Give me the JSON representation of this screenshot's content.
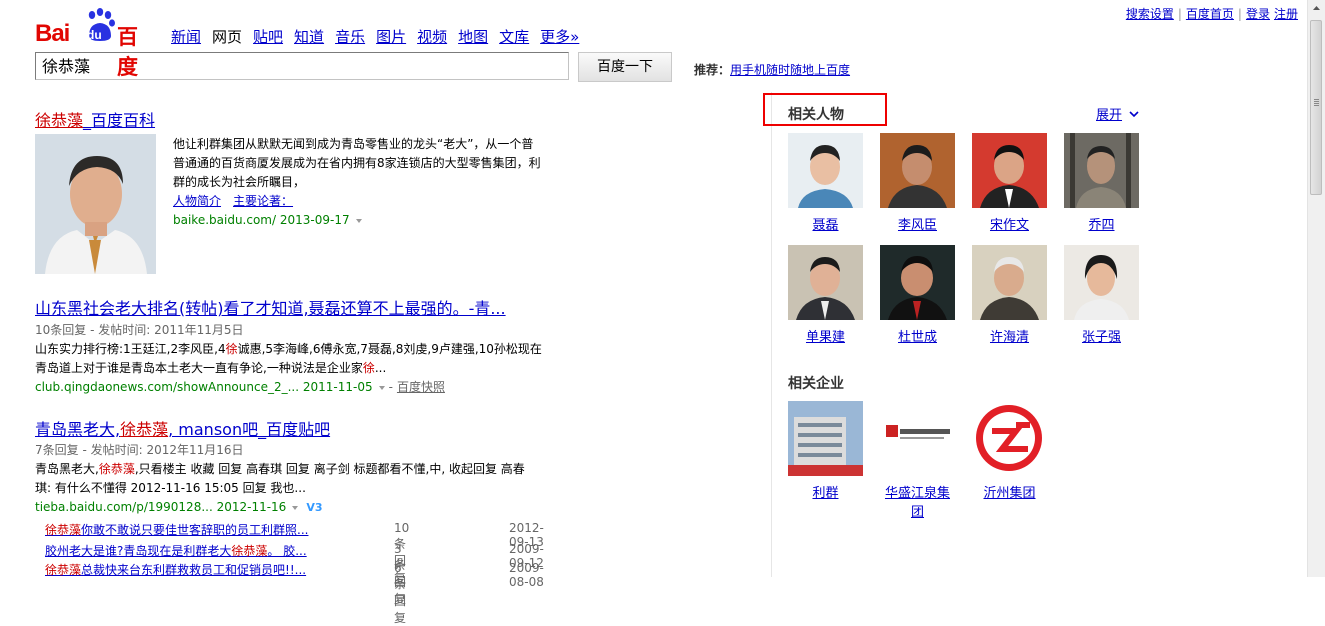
{
  "top_links": [
    "搜索设置",
    "百度首页",
    "登录",
    "注册"
  ],
  "logo": {
    "bai": "Bai",
    "du": "du",
    "cn": "百度"
  },
  "nav": [
    "新闻",
    "网页",
    "贴吧",
    "知道",
    "音乐",
    "图片",
    "视频",
    "地图",
    "文库",
    "更多»"
  ],
  "nav_current": "网页",
  "search": {
    "value": "徐恭藻",
    "button": "百度一下"
  },
  "recommend": {
    "label": "推荐：",
    "link": "用手机随时随地上百度"
  },
  "results": {
    "r1": {
      "title_q": "徐恭藻",
      "title_rest": "_百度百科",
      "desc1": "他让利群集团从默默无闻到成为青岛零售业的龙头“老大”，从一个普",
      "desc2": "普通通的百货商厦发展成为在省内拥有8家连锁店的大型零售集团，利",
      "desc3": "群的成长为社会所瞩目，",
      "link1": "人物简介",
      "link2": "主要论著：",
      "url": "baike.baidu.com/ 2013-09-17"
    },
    "r2": {
      "title": "山东黑社会老大排名(转帖)看了才知道,聂磊还算不上最强的。-青...",
      "meta": "10条回复 - 发帖时间: 2011年11月5日",
      "desc1_a": "山东实力排行榜:1王廷江,2李风臣,4",
      "desc1_q": "徐",
      "desc1_b": "诚惠,5李海峰,6傅永宽,7聂磊,8刘虔,9卢建强,10孙松现在",
      "desc2_a": "青岛道上对于谁是青岛本土老大一直有争论,一种说法是企业家",
      "desc2_q": "徐",
      "desc2_b": "...",
      "url": "club.qingdaonews.com/showAnnounce_2_... 2011-11-05",
      "snapshot": "百度快照"
    },
    "r3": {
      "title_a": "青岛黑老大,",
      "title_q": "徐恭藻",
      "title_b": ", manson吧_百度贴吧",
      "meta": "7条回复 - 发帖时间: 2012年11月16日",
      "desc1_a": "青岛黑老大,",
      "desc1_q": "徐恭藻",
      "desc1_b": ",只看楼主 收藏 回复 高春琪 回复 离子剑 标题都看不懂,中, 收起回复 高春",
      "desc2": "琪: 有什么不懂得 2012-11-16 15:05 回复 我也...",
      "url": "tieba.baidu.com/p/1990128... 2012-11-16",
      "badge": "V3",
      "sub": [
        {
          "q": "徐恭藻",
          "rest": "你敢不敢说只要佳世客辞职的员工利群照...",
          "count": "10条回复",
          "date": "2012-09-13"
        },
        {
          "pre": "胶州老大是谁?青岛现在是利群老大",
          "q": "徐恭藻",
          "rest": "。 胶...",
          "count": "3条回复",
          "date": "2009-09-12"
        },
        {
          "q": "徐恭藻",
          "rest": "总裁快来台东利群救救员工和促销员吧!!...",
          "count": "6条回复",
          "date": "2009-08-08"
        }
      ]
    }
  },
  "side": {
    "people_title": "相关人物",
    "expand": "展开",
    "people": [
      "聂磊",
      "李风臣",
      "宋作文",
      "乔四",
      "单果建",
      "杜世成",
      "许海清",
      "张子强"
    ],
    "company_title": "相关企业",
    "companies": [
      "利群",
      "华盛江泉集团",
      "沂州集团"
    ]
  }
}
